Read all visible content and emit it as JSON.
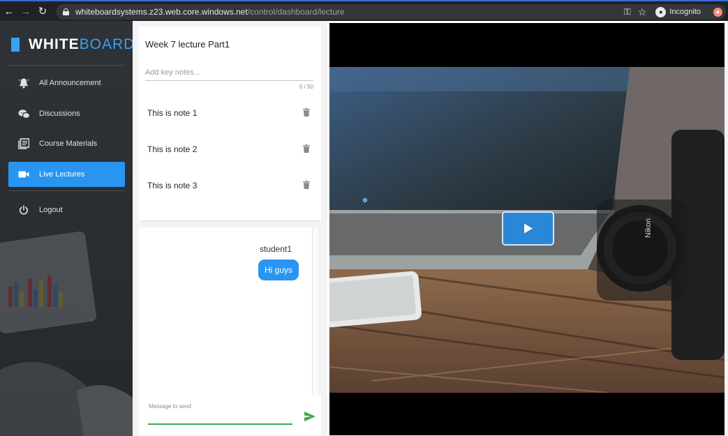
{
  "browser": {
    "url_host": "whiteboardsystems.z23.web.core.windows.net",
    "url_path": "/control/dashboard/lecture",
    "profile_label": "Incognito"
  },
  "brand": {
    "part1": "WHITE",
    "part2": "BOARD",
    "accent": "#3aa0f2"
  },
  "sidebar": {
    "items": [
      {
        "label": "All Announcement",
        "icon": "bell-icon"
      },
      {
        "label": "Discussions",
        "icon": "chat-bubbles-icon"
      },
      {
        "label": "Course Materials",
        "icon": "book-icon"
      },
      {
        "label": "Live Lectures",
        "icon": "video-camera-icon",
        "active": true
      },
      {
        "label": "Logout",
        "icon": "power-icon"
      }
    ]
  },
  "notes": {
    "lecture_title": "Week 7 lecture Part1",
    "input_placeholder": "Add key notes...",
    "counter": "0 / 50",
    "items": [
      "This is note 1",
      "This is note 2",
      "This is note 3"
    ]
  },
  "chat": {
    "messages": [
      {
        "sender": "student1",
        "text": "Hi guys"
      }
    ],
    "input_label": "Message to send",
    "send_color": "#3daa47"
  },
  "video": {
    "play_icon": "play-icon"
  },
  "colors": {
    "primary": "#2a95f0",
    "sidebar_bg": "#2b2f33"
  }
}
